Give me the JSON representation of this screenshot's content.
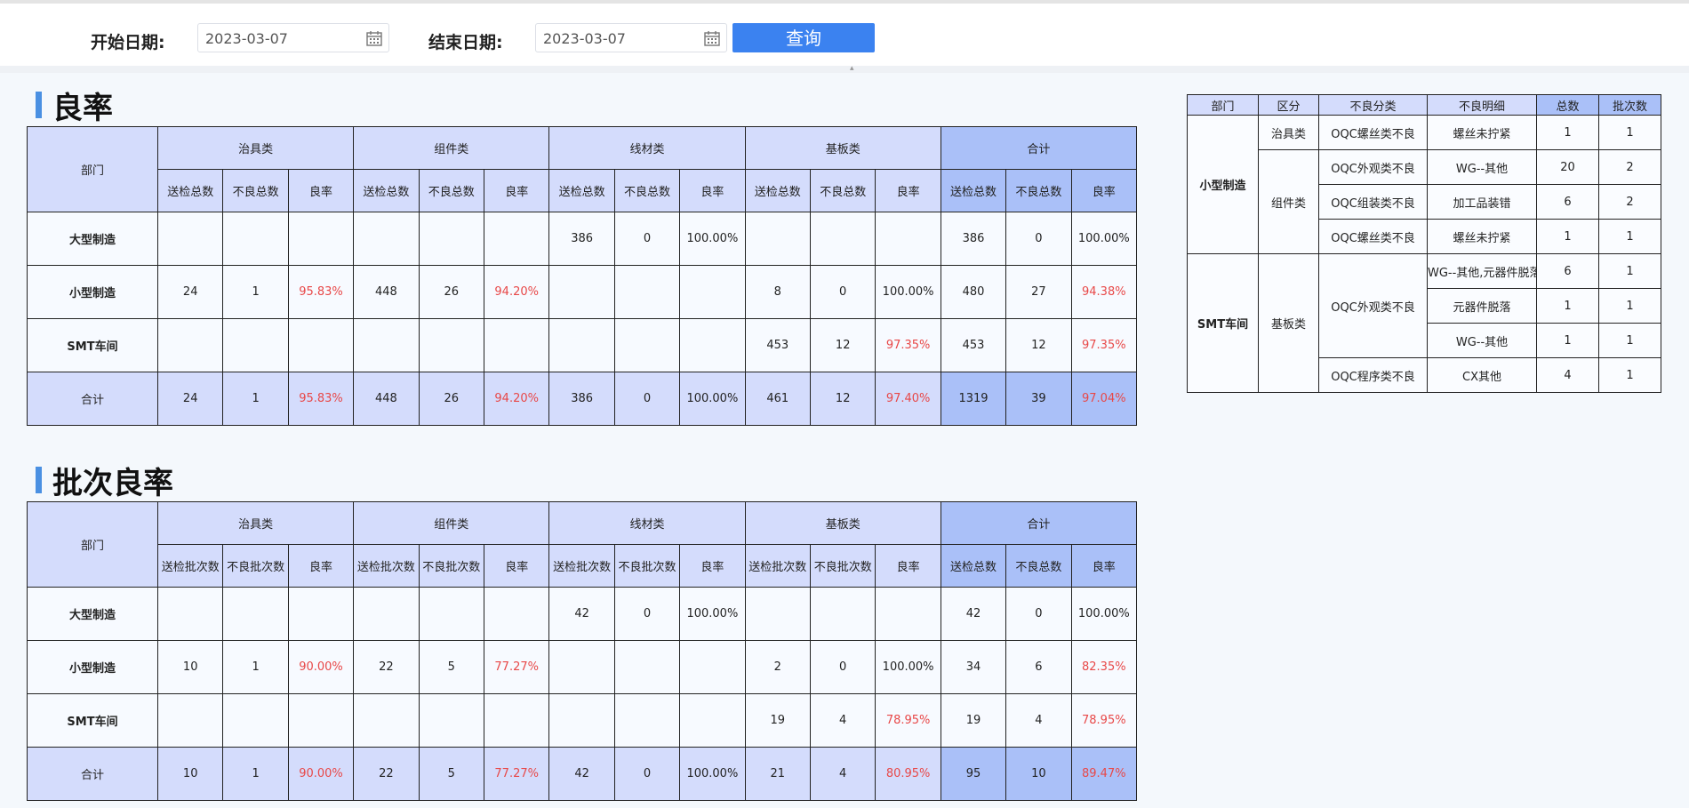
{
  "filters": {
    "start_label": "开始日期:",
    "start_value": "2023-03-07",
    "end_label": "结束日期:",
    "end_value": "2023-03-07",
    "query_label": "查询"
  },
  "yield": {
    "title": "良率",
    "dept_header": "部门",
    "groups": [
      "治具类",
      "组件类",
      "线材类",
      "基板类",
      "合计"
    ],
    "sub_headers": [
      "送检总数",
      "不良总数",
      "良率"
    ],
    "rows": [
      {
        "dept": "大型制造",
        "cells": [
          "",
          "",
          "",
          "",
          "",
          "",
          "386",
          "0",
          "100.00%",
          "",
          "",
          "",
          "386",
          "0",
          "100.00%"
        ]
      },
      {
        "dept": "小型制造",
        "cells": [
          "24",
          "1",
          "95.83%",
          "448",
          "26",
          "94.20%",
          "",
          "",
          "",
          "8",
          "0",
          "100.00%",
          "480",
          "27",
          "94.38%"
        ]
      },
      {
        "dept": "SMT车间",
        "cells": [
          "",
          "",
          "",
          "",
          "",
          "",
          "",
          "",
          "",
          "453",
          "12",
          "97.35%",
          "453",
          "12",
          "97.35%"
        ]
      }
    ],
    "total": {
      "dept": "合计",
      "cells": [
        "24",
        "1",
        "95.83%",
        "448",
        "26",
        "94.20%",
        "386",
        "0",
        "100.00%",
        "461",
        "12",
        "97.40%",
        "1319",
        "39",
        "97.04%"
      ]
    }
  },
  "batch": {
    "title": "批次良率",
    "dept_header": "部门",
    "groups": [
      "治具类",
      "组件类",
      "线材类",
      "基板类",
      "合计"
    ],
    "sub_headers": [
      "送检批次数",
      "不良批次数",
      "良率"
    ],
    "total_sub_headers": [
      "送检总数",
      "不良总数",
      "良率"
    ],
    "rows": [
      {
        "dept": "大型制造",
        "cells": [
          "",
          "",
          "",
          "",
          "",
          "",
          "42",
          "0",
          "100.00%",
          "",
          "",
          "",
          "42",
          "0",
          "100.00%"
        ]
      },
      {
        "dept": "小型制造",
        "cells": [
          "10",
          "1",
          "90.00%",
          "22",
          "5",
          "77.27%",
          "",
          "",
          "",
          "2",
          "0",
          "100.00%",
          "34",
          "6",
          "82.35%"
        ]
      },
      {
        "dept": "SMT车间",
        "cells": [
          "",
          "",
          "",
          "",
          "",
          "",
          "",
          "",
          "",
          "19",
          "4",
          "78.95%",
          "19",
          "4",
          "78.95%"
        ]
      }
    ],
    "total": {
      "dept": "合计",
      "cells": [
        "10",
        "1",
        "90.00%",
        "22",
        "5",
        "77.27%",
        "42",
        "0",
        "100.00%",
        "21",
        "4",
        "80.95%",
        "95",
        "10",
        "89.47%"
      ]
    }
  },
  "detail": {
    "headers": [
      "部门",
      "区分",
      "不良分类",
      "不良明细",
      "总数",
      "批次数"
    ],
    "depts": [
      "小型制造",
      "SMT车间"
    ],
    "categories": [
      "治具类",
      "组件类",
      "基板类"
    ],
    "types": [
      "OQC螺丝类不良",
      "OQC外观类不良",
      "OQC组装类不良",
      "OQC螺丝类不良",
      "OQC外观类不良",
      "OQC程序类不良"
    ],
    "rows": [
      {
        "detail": "螺丝未拧紧",
        "total": "1",
        "batches": "1"
      },
      {
        "detail": "WG--其他",
        "total": "20",
        "batches": "2"
      },
      {
        "detail": "加工品装错",
        "total": "6",
        "batches": "2"
      },
      {
        "detail": "螺丝未拧紧",
        "total": "1",
        "batches": "1"
      },
      {
        "detail": "WG--其他,元器件脱落",
        "total": "6",
        "batches": "1"
      },
      {
        "detail": "元器件脱落",
        "total": "1",
        "batches": "1"
      },
      {
        "detail": "WG--其他",
        "total": "1",
        "batches": "1"
      },
      {
        "detail": "CX其他",
        "total": "4",
        "batches": "1"
      }
    ]
  },
  "colors": {
    "accent": "#3b82f0",
    "header_bg": "#d4dcfc",
    "total_bg": "#aac0f8",
    "bad_rate": "#e84848"
  }
}
